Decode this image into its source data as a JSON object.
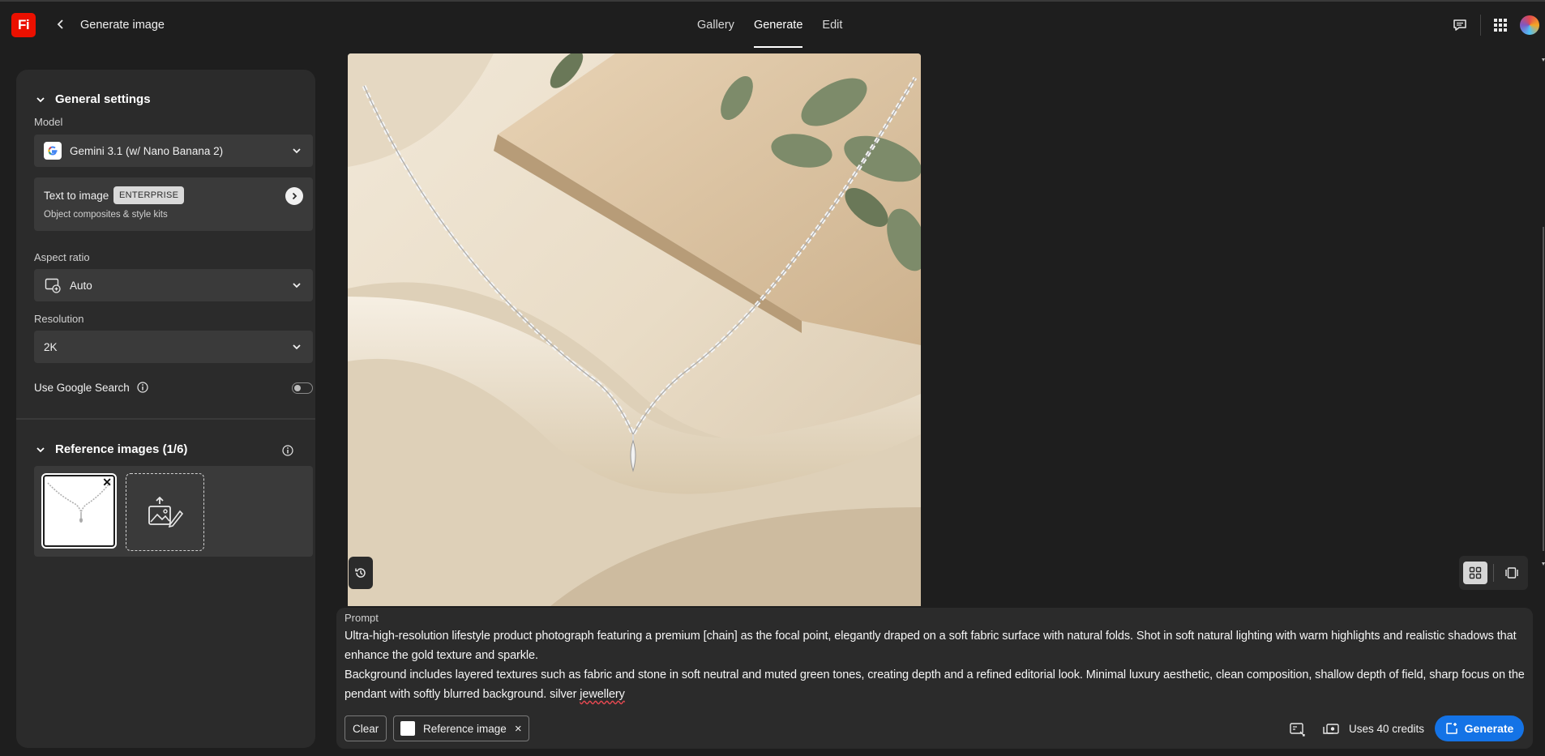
{
  "app": {
    "logo_text": "Fi",
    "page_title": "Generate image"
  },
  "nav": {
    "tabs": [
      {
        "label": "Gallery",
        "active": false
      },
      {
        "label": "Generate",
        "active": true
      },
      {
        "label": "Edit",
        "active": false
      }
    ]
  },
  "header_icons": [
    "feedback-icon",
    "apps-grid-icon",
    "avatar"
  ],
  "sidebar": {
    "general_settings": {
      "title": "General settings",
      "model_label": "Model",
      "model_value": "Gemini 3.1 (w/ Nano Banana 2)",
      "model_icon": "google-icon",
      "mode_card": {
        "title": "Text to image",
        "badge": "ENTERPRISE",
        "subtitle": "Object composites & style kits"
      },
      "aspect_label": "Aspect ratio",
      "aspect_value": "Auto",
      "resolution_label": "Resolution",
      "resolution_value": "2K",
      "google_search_label": "Use Google Search",
      "google_search_enabled": false
    },
    "reference_images": {
      "title": "Reference images (1/6)",
      "count": 1,
      "max": 6
    }
  },
  "prompt": {
    "label": "Prompt",
    "paragraph1": "Ultra-high-resolution lifestyle product photograph featuring a premium [chain] as the focal point, elegantly draped on a soft fabric surface with natural folds. Shot in soft natural lighting with warm highlights and realistic shadows that enhance the gold texture and sparkle.",
    "paragraph2_main": "Background includes layered textures such as fabric and stone in soft neutral and muted green tones, creating depth and a refined editorial look. Minimal luxury aesthetic, clean composition, shallow depth of field, sharp focus on the pendant with softly blurred background. silver ",
    "paragraph2_misspelled": "jewellery",
    "clear_label": "Clear",
    "chip_label": "Reference image",
    "credits_label": "Uses 40 credits",
    "generate_label": "Generate"
  },
  "colors": {
    "accent": "#1473e6",
    "logo": "#eb1000",
    "background": "#1e1e1e",
    "panel": "#2b2b2b",
    "control": "#3a3a3a"
  }
}
